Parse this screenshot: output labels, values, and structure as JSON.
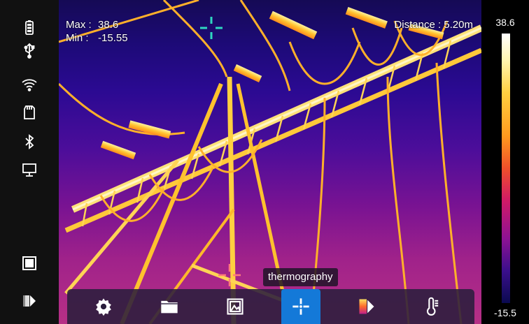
{
  "readouts": {
    "max_label": "Max :",
    "max_value": "38.6",
    "min_label": "Min :",
    "min_value": "-15.55",
    "distance_label": "Distance :",
    "distance_value": "5.20m"
  },
  "colorbar": {
    "max_value": "38.6",
    "min_value": "-15.5",
    "palette": [
      "#ffffff",
      "#ffd040",
      "#f0502a",
      "#8e1294",
      "#0a0a50"
    ]
  },
  "status_icons": [
    "battery-icon",
    "usb-icon",
    "wifi-icon",
    "sd-card-icon",
    "bluetooth-icon",
    "monitor-icon"
  ],
  "left_controls": [
    "square-frame-icon",
    "palette-toggle-icon"
  ],
  "toolbar": {
    "tooltip": "thermography",
    "buttons": [
      "settings-icon",
      "folder-icon",
      "image-gallery-icon",
      "measure-point-icon",
      "palette-icon",
      "thermometer-icon"
    ],
    "active": "measure-point-icon"
  },
  "colors": {
    "crosshair_center": "#2fd7c0",
    "crosshair_spot": "#ff7a7a",
    "active_button": "#1479d8"
  }
}
